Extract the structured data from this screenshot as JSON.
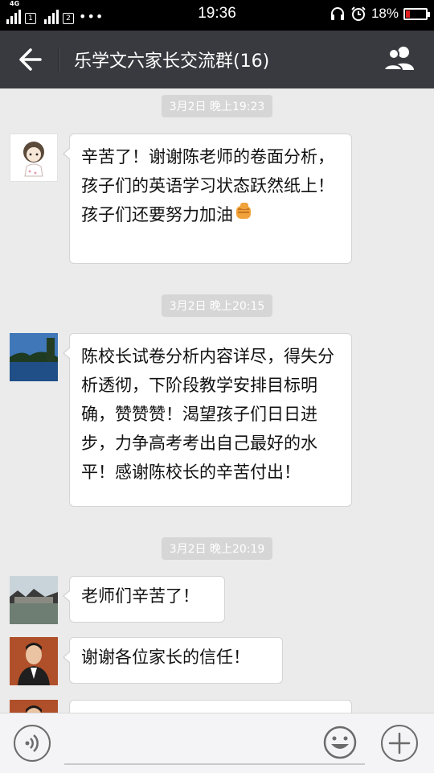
{
  "status_bar": {
    "network_label": "4G",
    "time": "19:36",
    "battery_percent": "18%",
    "battery_level": 0.18,
    "icons": [
      "signal-icon",
      "sim-icon",
      "signal-icon",
      "sim-icon",
      "more-icon",
      "headset-icon",
      "alarm-icon",
      "battery-icon"
    ]
  },
  "header": {
    "title": "乐学文六家长交流群(16)",
    "back_icon": "back-arrow-icon",
    "members_icon": "group-members-icon",
    "background": "#393a3f"
  },
  "messages": [
    {
      "type": "timestamp",
      "text": "3月2日 晚上19:23"
    },
    {
      "type": "message",
      "sender_avatar": "cartoon-girl-avatar",
      "text": "辛苦了！谢谢陈老师的卷面分析，孩子们的英语学习状态跃然纸上！孩子们还要努力加油",
      "emoji": "fist-emoji"
    },
    {
      "type": "timestamp",
      "text": "3月2日 晚上20:15"
    },
    {
      "type": "message",
      "sender_avatar": "lake-photo-avatar",
      "text": "陈校长试卷分析内容详尽，得失分析透彻，下阶段教学安排目标明确，赞赞赞！渴望孩子们日日进步，力争高考考出自己最好的水平！感谢陈校长的辛苦付出！"
    },
    {
      "type": "timestamp",
      "text": "3月2日 晚上20:19"
    },
    {
      "type": "message",
      "sender_avatar": "river-town-avatar",
      "text": "老师们辛苦了！"
    },
    {
      "type": "message",
      "sender_avatar": "man-portrait-avatar",
      "text": "谢谢各位家长的信任！"
    },
    {
      "type": "message",
      "sender_avatar": "man-portrait-avatar",
      "text": ""
    }
  ],
  "input_bar": {
    "voice_icon": "voice-icon",
    "text_value": "",
    "placeholder": "",
    "emoji_icon": "emoji-icon",
    "plus_icon": "plus-icon"
  }
}
